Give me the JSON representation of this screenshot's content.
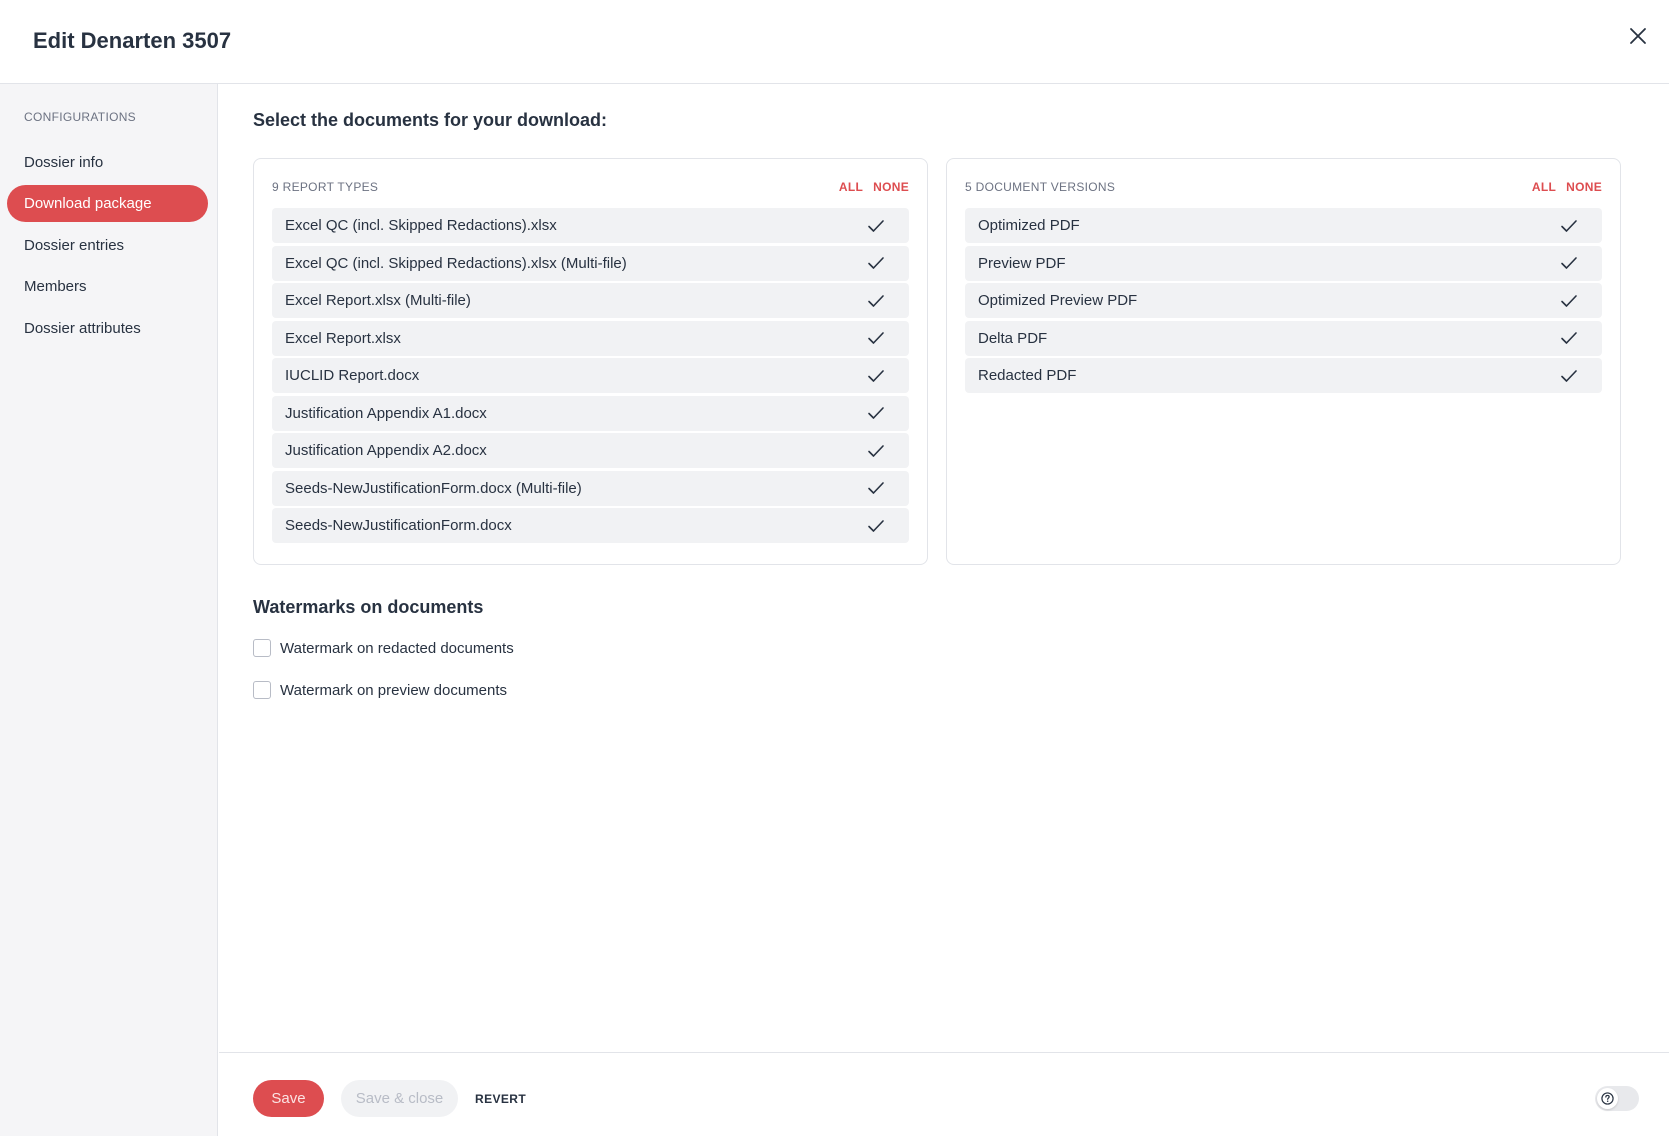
{
  "header": {
    "title": "Edit Denarten 3507"
  },
  "sidebar": {
    "section_label": "CONFIGURATIONS",
    "items": [
      {
        "label": "Dossier info",
        "active": false
      },
      {
        "label": "Download package",
        "active": true
      },
      {
        "label": "Dossier entries",
        "active": false
      },
      {
        "label": "Members",
        "active": false
      },
      {
        "label": "Dossier attributes",
        "active": false
      }
    ]
  },
  "main": {
    "heading": "Select the documents for your download:",
    "report_types": {
      "count_label": "9 REPORT TYPES",
      "all_label": "ALL",
      "none_label": "NONE",
      "items": [
        "Excel QC (incl. Skipped Redactions).xlsx",
        "Excel QC (incl. Skipped Redactions).xlsx (Multi-file)",
        "Excel Report.xlsx (Multi-file)",
        "Excel Report.xlsx",
        "IUCLID Report.docx",
        "Justification Appendix A1.docx",
        "Justification Appendix A2.docx",
        "Seeds-NewJustificationForm.docx (Multi-file)",
        "Seeds-NewJustificationForm.docx"
      ]
    },
    "document_versions": {
      "count_label": "5 DOCUMENT VERSIONS",
      "all_label": "ALL",
      "none_label": "NONE",
      "items": [
        "Optimized PDF",
        "Preview PDF",
        "Optimized Preview PDF",
        "Delta PDF",
        "Redacted PDF"
      ]
    },
    "watermarks": {
      "heading": "Watermarks on documents",
      "options": [
        {
          "label": "Watermark on redacted documents",
          "checked": false
        },
        {
          "label": "Watermark on preview documents",
          "checked": false
        }
      ]
    }
  },
  "footer": {
    "save_label": "Save",
    "save_close_label": "Save & close",
    "revert_label": "REVERT"
  },
  "colors": {
    "accent": "#dd4d50",
    "text": "#283241",
    "muted": "#6c7282",
    "row_bg": "#f1f2f4",
    "sidebar_bg": "#f5f5f7"
  },
  "icons": {
    "close": "close-icon",
    "check": "check-icon",
    "help": "help-icon"
  }
}
